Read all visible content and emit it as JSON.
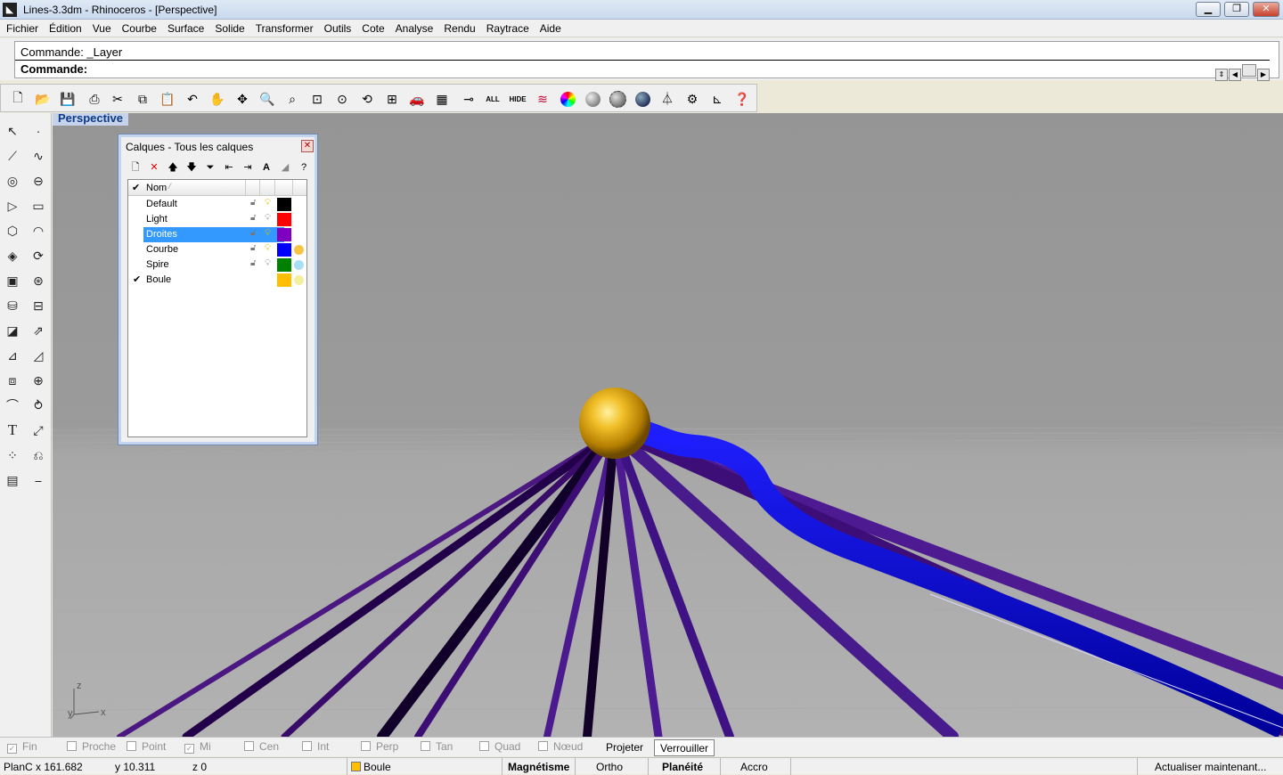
{
  "window": {
    "title": "Lines-3.3dm - Rhinoceros - [Perspective]",
    "app_icon": "rhino-icon",
    "buttons": [
      "minimize-icon",
      "restore-icon",
      "close-icon"
    ]
  },
  "menu": [
    "Fichier",
    "Édition",
    "Vue",
    "Courbe",
    "Surface",
    "Solide",
    "Transformer",
    "Outils",
    "Cote",
    "Analyse",
    "Rendu",
    "Raytrace",
    "Aide"
  ],
  "command": {
    "history": "Commande: _Layer",
    "prompt": "Commande:"
  },
  "toolbar": {
    "all_label": "ALL",
    "hide_label": "HIDE"
  },
  "viewport": {
    "title": "Perspective",
    "axis_z": "z",
    "axis_y": "y",
    "axis_x": "x"
  },
  "layers_panel": {
    "title": "Calques - Tous les calques",
    "column_name": "Nom",
    "rows": [
      {
        "name": "Default",
        "current": false,
        "selected": false,
        "color": "#000000",
        "material": "#ffffff"
      },
      {
        "name": "Light",
        "current": false,
        "selected": false,
        "color": "#ff0000",
        "material": "#ffffff"
      },
      {
        "name": "Droites",
        "current": false,
        "selected": true,
        "color": "#8000c0",
        "material": "#ffffff"
      },
      {
        "name": "Courbe",
        "current": false,
        "selected": false,
        "color": "#0000ff",
        "material": "#f6c445"
      },
      {
        "name": "Spire",
        "current": false,
        "selected": false,
        "color": "#008000",
        "material": "#a8dff5"
      },
      {
        "name": "Boule",
        "current": true,
        "selected": false,
        "color": "#ffbf00",
        "material": "#f3ef9c"
      }
    ]
  },
  "osnap": {
    "items": [
      {
        "label": "Fin",
        "checked": true
      },
      {
        "label": "Proche",
        "checked": false
      },
      {
        "label": "Point",
        "checked": false
      },
      {
        "label": "Mi",
        "checked": true
      },
      {
        "label": "Cen",
        "checked": false
      },
      {
        "label": "Int",
        "checked": false
      },
      {
        "label": "Perp",
        "checked": false
      },
      {
        "label": "Tan",
        "checked": false
      },
      {
        "label": "Quad",
        "checked": false
      },
      {
        "label": "Nœud",
        "checked": false
      }
    ],
    "projeter": "Projeter",
    "verrouiller": "Verrouiller"
  },
  "status": {
    "plane": "PlanC",
    "x": "x 161.682",
    "y": "y 10.311",
    "z": "z 0",
    "layer": "Boule",
    "layer_color": "#ffbf00",
    "magnetisme": "Magnétisme",
    "ortho": "Ortho",
    "planeite": "Planéité",
    "accro": "Accro",
    "update": "Actualiser maintenant..."
  }
}
